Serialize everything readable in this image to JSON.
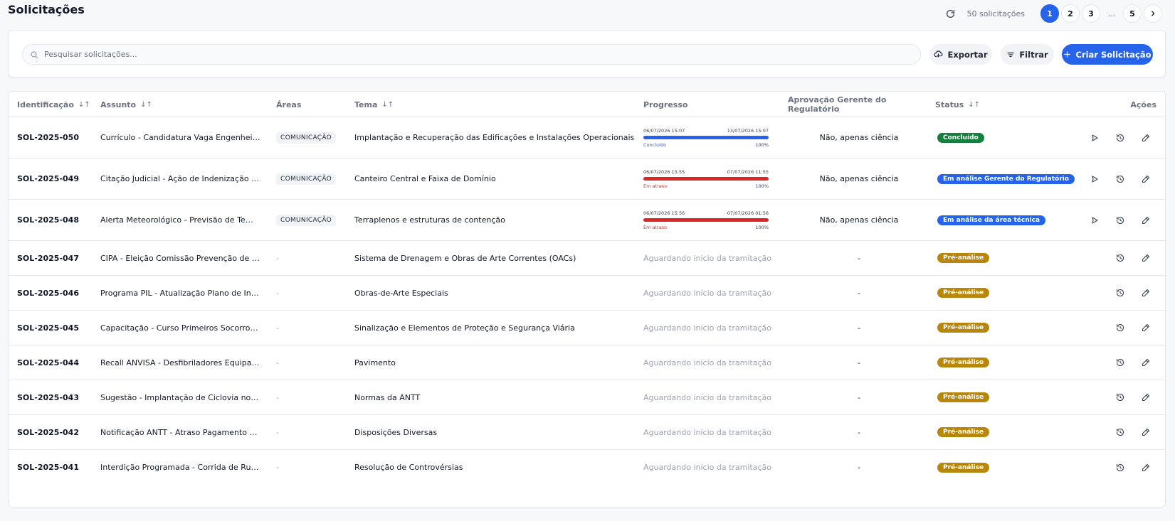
{
  "header": {
    "title": "Solicitações",
    "count_label": "50 solicitações",
    "pages": [
      "1",
      "2",
      "3",
      "...",
      "5"
    ],
    "active_page": "1"
  },
  "toolbar": {
    "search_placeholder": "Pesquisar solicitações...",
    "search_value": "",
    "export_label": "Exportar",
    "filter_label": "Filtrar",
    "create_label": "Criar Solicitação"
  },
  "colors": {
    "primary": "#2563eb",
    "success": "#15803d",
    "danger": "#dc2626",
    "warning": "#b8860b"
  },
  "table": {
    "columns": {
      "id": "Identificação",
      "subject": "Assunto",
      "areas": "Áreas",
      "theme": "Tema",
      "progress": "Progresso",
      "approval": "Aprovação Gerente do Regulatório",
      "status": "Status",
      "actions": "Ações"
    },
    "rows": [
      {
        "id": "SOL-2025-050",
        "subject": "Currículo - Candidatura Vaga Engenheiro ...",
        "area": "COMUNICAÇÃO",
        "theme": "Implantação e Recuperação das Edificações e Instalações Operacionais",
        "progress": {
          "start": "06/07/2026 15:07",
          "end": "13/07/2026 15:07",
          "label": "Concluído",
          "percent": "100%",
          "fill": 1.0,
          "color": "blue"
        },
        "approval": "Não, apenas ciência",
        "status": "Concluído",
        "status_color": "#15803d",
        "has_send": true
      },
      {
        "id": "SOL-2025-049",
        "subject": "Citação Judicial - Ação de Indenização po...",
        "area": "COMUNICAÇÃO",
        "theme": "Canteiro Central e Faixa de Domínio",
        "progress": {
          "start": "06/07/2026 15:55",
          "end": "07/07/2026 11:55",
          "label": "Em atraso",
          "percent": "100%",
          "fill": 1.0,
          "color": "red"
        },
        "approval": "Não, apenas ciência",
        "status": "Em análise Gerente do Regulatório",
        "status_color": "#2563eb",
        "has_send": true
      },
      {
        "id": "SOL-2025-048",
        "subject": "Alerta Meteorológico - Previsão de Tempo...",
        "area": "COMUNICAÇÃO",
        "theme": "Terraplenos e estruturas de contenção",
        "progress": {
          "start": "06/07/2026 15:56",
          "end": "07/07/2026 01:56",
          "label": "Em atraso",
          "percent": "100%",
          "fill": 1.0,
          "color": "red"
        },
        "approval": "Não, apenas ciência",
        "status": "Em análise da área técnica",
        "status_color": "#2563eb",
        "has_send": true
      },
      {
        "id": "SOL-2025-047",
        "subject": "CIPA - Eleição Comissão Prevenção de Aci...",
        "area": "-",
        "theme": "Sistema de Drenagem e Obras de Arte Correntes (OACs)",
        "waiting": "Aguardando início da tramitação",
        "approval": "-",
        "status": "Pré-análise",
        "status_color": "#b8860b",
        "has_send": false
      },
      {
        "id": "SOL-2025-046",
        "subject": "Programa PIL - Atualização Plano de Inve...",
        "area": "-",
        "theme": "Obras-de-Arte Especiais",
        "waiting": "Aguardando início da tramitação",
        "approval": "-",
        "status": "Pré-análise",
        "status_color": "#b8860b",
        "has_send": false
      },
      {
        "id": "SOL-2025-045",
        "subject": "Capacitação - Curso Primeiros Socorros E...",
        "area": "-",
        "theme": "Sinalização e Elementos de Proteção e Segurança Viária",
        "waiting": "Aguardando início da tramitação",
        "approval": "-",
        "status": "Pré-análise",
        "status_color": "#b8860b",
        "has_send": false
      },
      {
        "id": "SOL-2025-044",
        "subject": "Recall ANVISA - Desfibriladores Equipam...",
        "area": "-",
        "theme": "Pavimento",
        "waiting": "Aguardando início da tramitação",
        "approval": "-",
        "status": "Pré-análise",
        "status_color": "#b8860b",
        "has_send": false
      },
      {
        "id": "SOL-2025-043",
        "subject": "Sugestão - Implantação de Ciclovia no Ac...",
        "area": "-",
        "theme": "Normas da ANTT",
        "waiting": "Aguardando início da tramitação",
        "approval": "-",
        "status": "Pré-análise",
        "status_color": "#b8860b",
        "has_send": false
      },
      {
        "id": "SOL-2025-042",
        "subject": "Notificação ANTT - Atraso Pagamento de ...",
        "area": "-",
        "theme": "Disposições Diversas",
        "waiting": "Aguardando início da tramitação",
        "approval": "-",
        "status": "Pré-análise",
        "status_color": "#b8860b",
        "has_send": false
      },
      {
        "id": "SOL-2025-041",
        "subject": "Interdição Programada - Corrida de Rua k...",
        "area": "-",
        "theme": "Resolução de Controvérsias",
        "waiting": "Aguardando início da tramitação",
        "approval": "-",
        "status": "Pré-análise",
        "status_color": "#b8860b",
        "has_send": false
      }
    ]
  }
}
